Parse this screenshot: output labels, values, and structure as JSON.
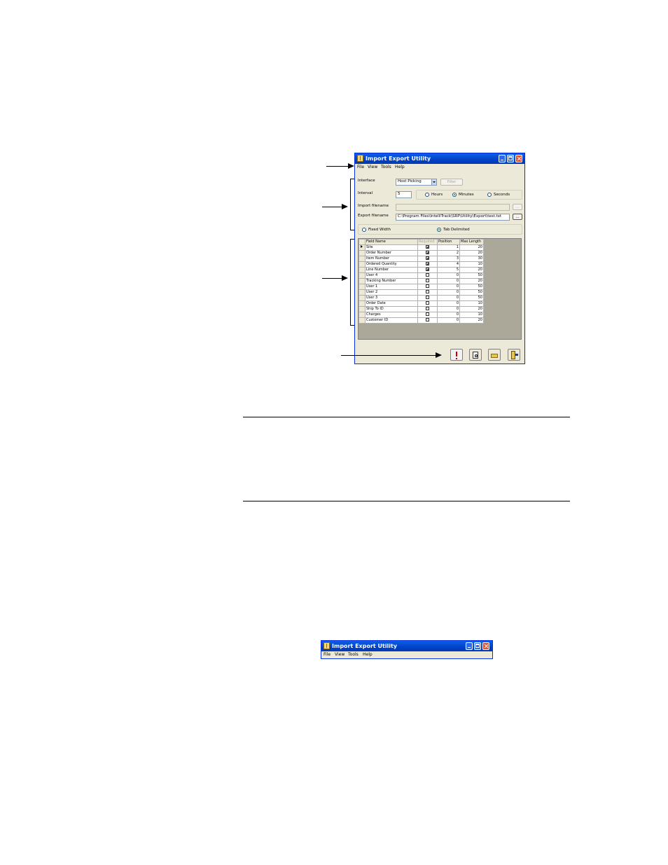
{
  "window": {
    "title": "Import Export Utility",
    "menu": [
      "File",
      "View",
      "Tools",
      "Help"
    ]
  },
  "form": {
    "interface_label": "Interface",
    "interface_value": "Host Picking",
    "filter_button": "Filter",
    "interval_label": "Interval",
    "interval_value": "5",
    "interval_units": [
      {
        "label": "Hours",
        "selected": false
      },
      {
        "label": "Minutes",
        "selected": true
      },
      {
        "label": "Seconds",
        "selected": false
      }
    ],
    "import_label": "Import filename",
    "import_value": "",
    "browse_button": "...",
    "export_label": "Export filename",
    "export_value": "C:\\Program Files\\IntelliTrack\\SRP\\Utility\\Export\\test.txt",
    "format_options": [
      {
        "label": "Fixed Width",
        "selected": false
      },
      {
        "label": "Tab Delimited",
        "selected": true
      }
    ]
  },
  "grid": {
    "columns": [
      "Field Name",
      "Required",
      "Position",
      "Max Length"
    ],
    "rows": [
      {
        "name": "Site",
        "required": true,
        "position": "1",
        "max": "20",
        "current": true
      },
      {
        "name": "Order Number",
        "required": true,
        "position": "2",
        "max": "20"
      },
      {
        "name": "Item Number",
        "required": true,
        "position": "3",
        "max": "30"
      },
      {
        "name": "Ordered Quantity",
        "required": true,
        "position": "4",
        "max": "10"
      },
      {
        "name": "Line Number",
        "required": true,
        "position": "5",
        "max": "20"
      },
      {
        "name": "User 4",
        "required": false,
        "position": "0",
        "max": "50"
      },
      {
        "name": "Tracking Number",
        "required": false,
        "position": "0",
        "max": "20"
      },
      {
        "name": "User 1",
        "required": false,
        "position": "0",
        "max": "50"
      },
      {
        "name": "User 2",
        "required": false,
        "position": "0",
        "max": "50"
      },
      {
        "name": "User 3",
        "required": false,
        "position": "0",
        "max": "50"
      },
      {
        "name": "Order Date",
        "required": false,
        "position": "0",
        "max": "10"
      },
      {
        "name": "Ship To ID",
        "required": false,
        "position": "0",
        "max": "20"
      },
      {
        "name": "Charges",
        "required": false,
        "position": "0",
        "max": "10"
      },
      {
        "name": "Customer ID",
        "required": false,
        "position": "0",
        "max": "20"
      }
    ]
  },
  "toolbar": [
    "run-icon",
    "preview-icon",
    "open-folder-icon",
    "exit-icon"
  ],
  "small_window": {
    "title": "Import Export Utility",
    "menu": [
      "File",
      "View",
      "Tools",
      "Help"
    ]
  }
}
